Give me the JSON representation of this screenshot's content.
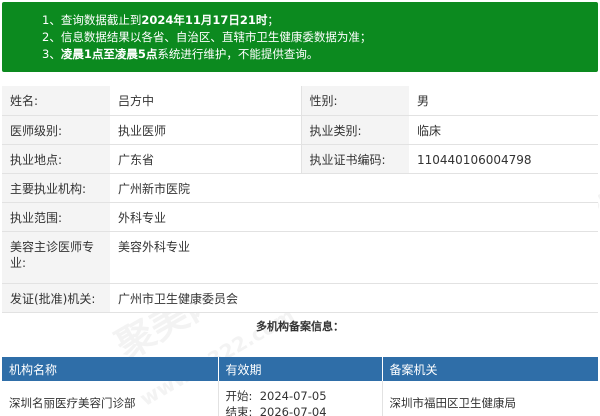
{
  "notice": {
    "line1_prefix": "1、查询数据截止到",
    "line1_bold": "2024年11月17日21时",
    "line1_suffix": "；",
    "line2": "2、信息数据结果以各省、自治区、直辖市卫生健康委数据为准；",
    "line3_prefix": "3、",
    "line3_bold": "凌晨1点至凌晨5点",
    "line3_suffix": "系统进行维护，不能提供查询。"
  },
  "info": {
    "name_label": "姓名:",
    "name": "吕方中",
    "gender_label": "性别:",
    "gender": "男",
    "level_label": "医师级别:",
    "level": "执业医师",
    "category_label": "执业类别:",
    "category": "临床",
    "location_label": "执业地点:",
    "location": "广东省",
    "cert_label": "执业证书编码:",
    "cert": "110440106004798",
    "institution_label": "主要执业机构:",
    "institution": "广州新市医院",
    "scope_label": "执业范围:",
    "scope": "外科专业",
    "cosmetic_label": "美容主诊医师专业:",
    "cosmetic": "美容外科专业",
    "issuer_label": "发证(批准)机关:",
    "issuer": "广州市卫生健康委员会"
  },
  "section_title": "多机构备案信息：",
  "inst_table": {
    "headers": [
      "机构名称",
      "有效期",
      "备案机关"
    ],
    "rows": [
      {
        "name": "深圳名丽医疗美容门诊部",
        "start_label": "开始:",
        "start": "2024-07-05",
        "end_label": "结束:",
        "end": "2026-07-04",
        "authority": "深圳市福田区卫生健康局"
      }
    ]
  },
  "watermark": {
    "brand": "聚美网",
    "site": "www.it322.com"
  }
}
